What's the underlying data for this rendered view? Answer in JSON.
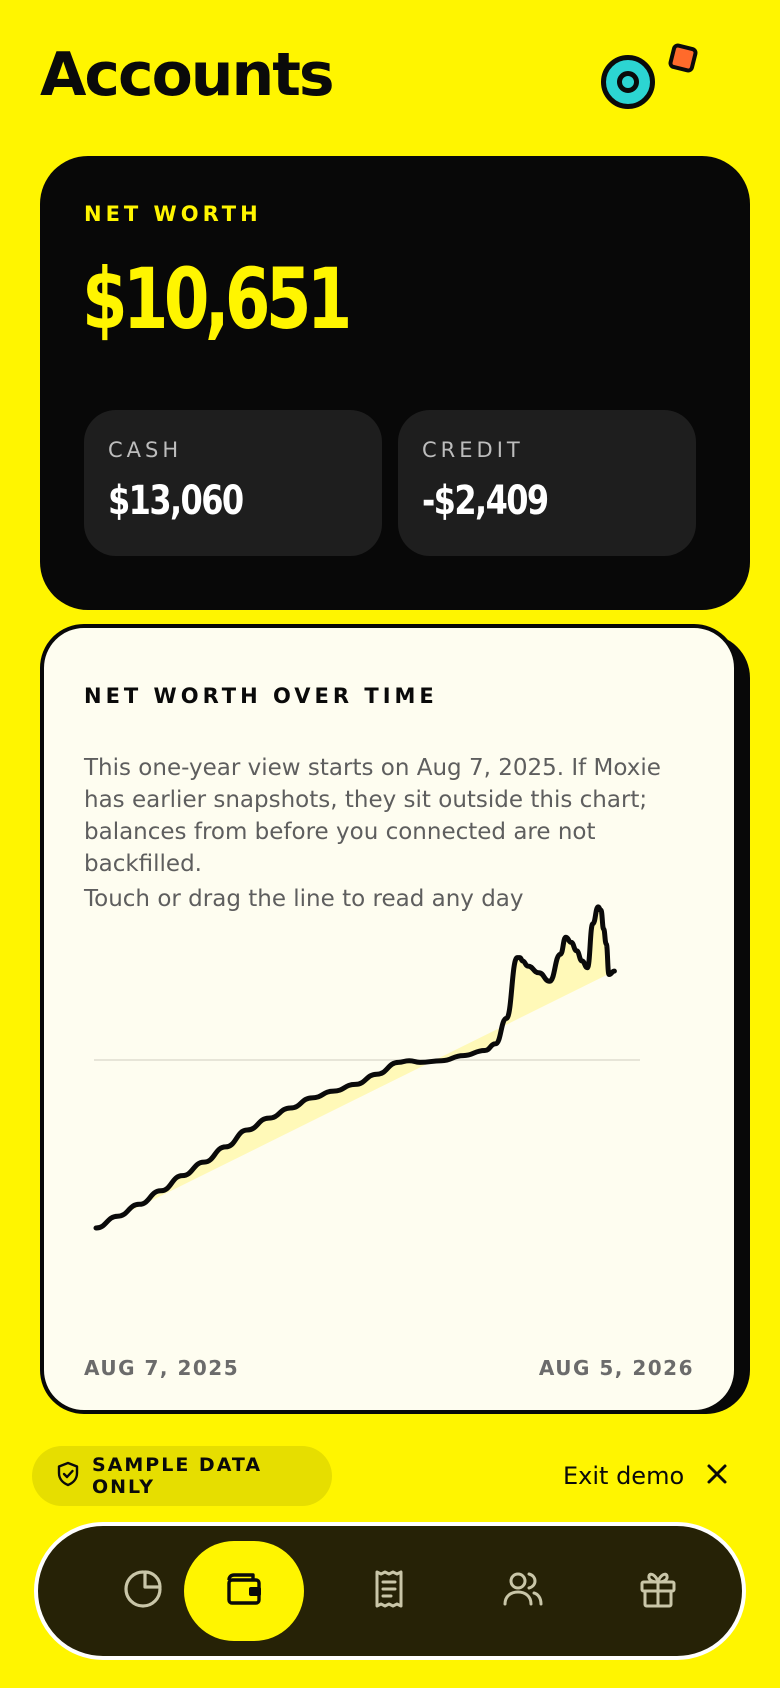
{
  "header": {
    "title": "Accounts"
  },
  "net_worth": {
    "label": "NET WORTH",
    "value": "$10,651",
    "cash": {
      "label": "CASH",
      "value": "$13,060"
    },
    "credit": {
      "label": "CREDIT",
      "value": "-$2,409"
    }
  },
  "chart_card": {
    "title": "NET WORTH OVER TIME",
    "description": "This one-year view starts on Aug 7, 2025. If Moxie has earlier snapshots, they sit outside this chart; balances from before you connected are not backfilled.",
    "hint": "Touch or drag the line to read any day",
    "start_label": "AUG 7, 2025",
    "end_label": "AUG 5, 2026"
  },
  "chart_data": {
    "type": "area",
    "title": "NET WORTH OVER TIME",
    "xlabel": "",
    "ylabel": "",
    "x_start": "AUG 7, 2025",
    "x_end": "AUG 5, 2026",
    "grid": "single horizontal reference line",
    "line_color": "#0a0a0a",
    "fill_color": "#fff9b8",
    "x": [
      0,
      0.04,
      0.08,
      0.12,
      0.16,
      0.2,
      0.24,
      0.28,
      0.32,
      0.36,
      0.4,
      0.44,
      0.48,
      0.52,
      0.56,
      0.58,
      0.6,
      0.64,
      0.68,
      0.72,
      0.74,
      0.76,
      0.78,
      0.785,
      0.79,
      0.8,
      0.82,
      0.84,
      0.86,
      0.87,
      0.88,
      0.89,
      0.9,
      0.91,
      0.92,
      0.93,
      0.935,
      0.94,
      0.945,
      0.95,
      0.96,
      0.97,
      0.975,
      0.98,
      0.99,
      1.0
    ],
    "values": [
      0,
      0.035,
      0.07,
      0.11,
      0.155,
      0.195,
      0.24,
      0.29,
      0.325,
      0.355,
      0.385,
      0.405,
      0.425,
      0.455,
      0.49,
      0.495,
      0.49,
      0.495,
      0.51,
      0.525,
      0.545,
      0.62,
      0.8,
      0.8,
      0.79,
      0.775,
      0.755,
      0.73,
      0.81,
      0.86,
      0.845,
      0.82,
      0.79,
      0.77,
      0.9,
      0.95,
      0.94,
      0.885,
      0.84,
      0.75,
      0.76
    ]
  },
  "demo": {
    "badge_label": "SAMPLE DATA ONLY",
    "badge_icon": "shield-check-icon",
    "exit_label": "Exit demo",
    "exit_icon": "close-icon"
  },
  "nav": {
    "items": [
      {
        "icon": "pie-chart-icon",
        "active": false
      },
      {
        "icon": "wallet-icon",
        "active": true
      },
      {
        "icon": "receipt-icon",
        "active": false
      },
      {
        "icon": "users-icon",
        "active": false
      },
      {
        "icon": "gift-icon",
        "active": false
      }
    ]
  },
  "colors": {
    "background": "#FFF500",
    "card_dark": "#080808",
    "sub_card": "#1e1e1e",
    "chart_card": "#fefdf0",
    "accent_teal": "#2cd5d2",
    "accent_orange": "#ff6a2b",
    "nav_bg": "#262206"
  }
}
